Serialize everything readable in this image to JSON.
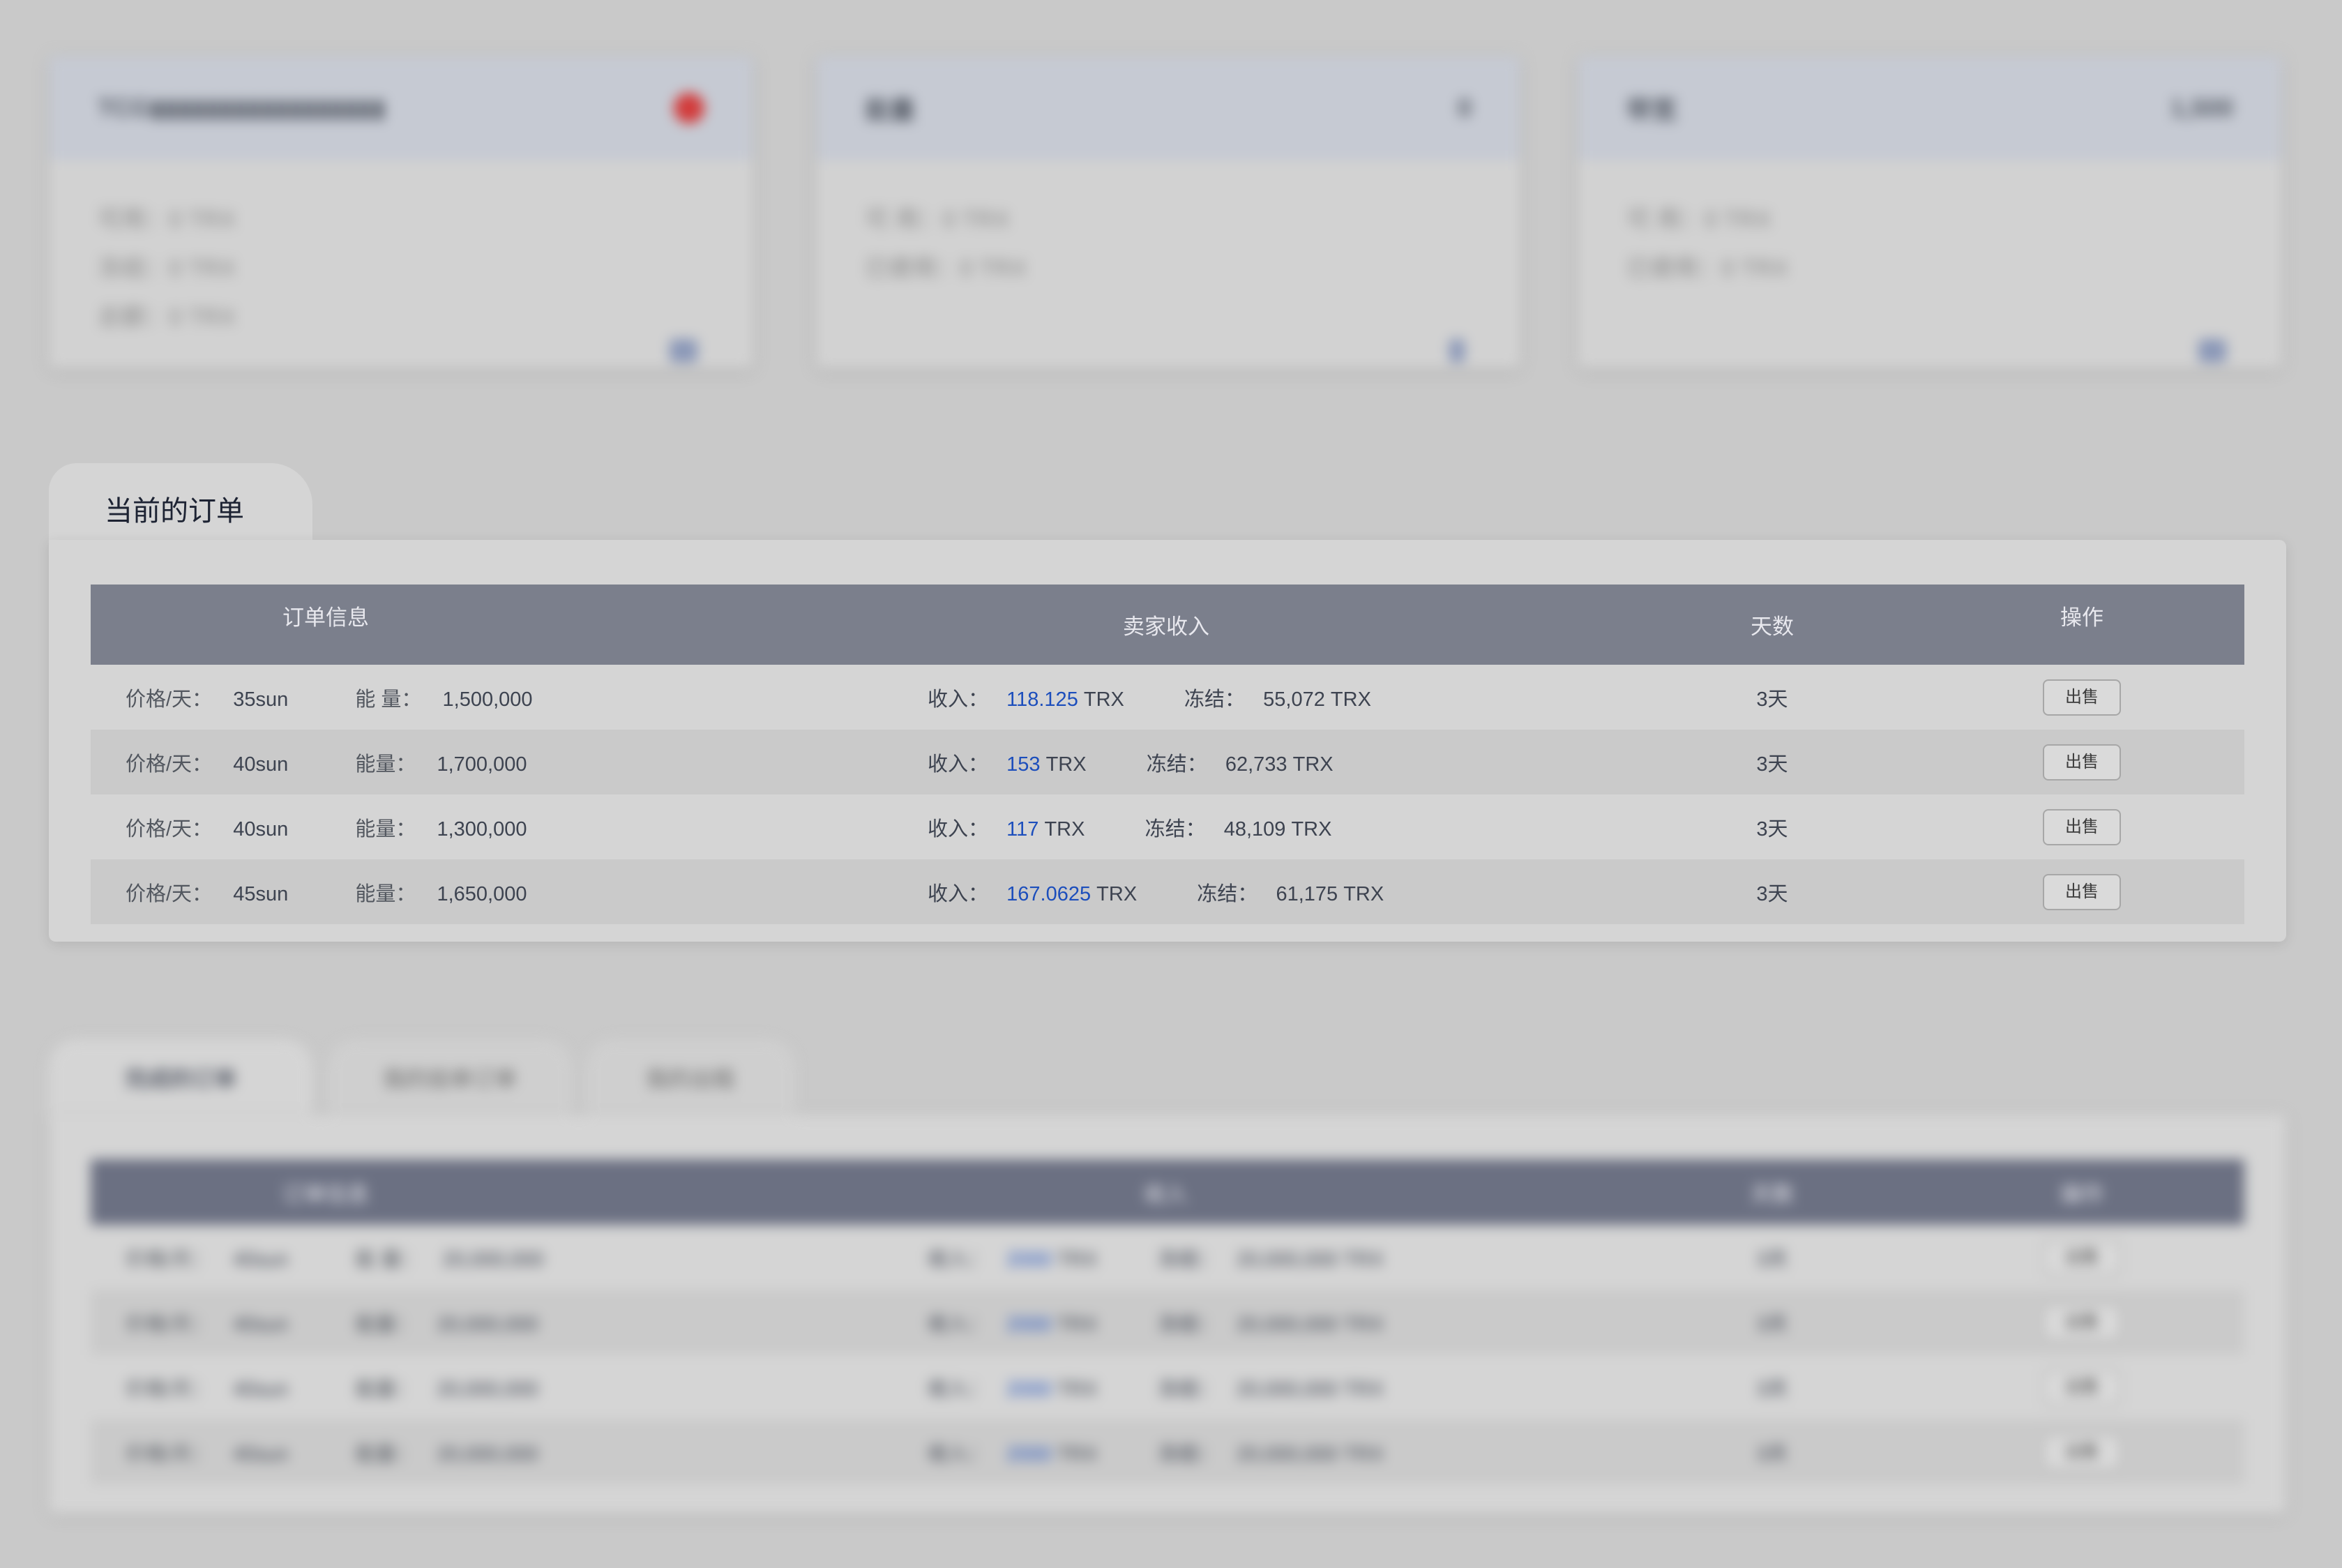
{
  "cards": [
    {
      "title": "TCG▮▮▮▮▮▮▮▮▮▮▮▮▮▮▮▮▮",
      "rows": [
        "可用：0 TRX",
        "冻结：0 TRX",
        "总额：0 TRX"
      ],
      "icon": "status-dot"
    },
    {
      "title": "能量",
      "badge": "0",
      "rows": [
        "可 用：0 TRX",
        "已使用：0 TRX"
      ],
      "icon": "bolt-icon"
    },
    {
      "title": "带宽",
      "badge": "1,500",
      "rows": [
        "可 用：0 TRX",
        "已使用：0 TRX"
      ],
      "icon": "bandwidth-icon"
    }
  ],
  "current_orders": {
    "tab_title": "当前的订单",
    "columns": [
      "订单信息",
      "卖家收入",
      "天数",
      "操作"
    ],
    "rows": [
      {
        "price_label": "价格/天：",
        "price": "35sun",
        "energy_label": "能 量：",
        "energy": "1,500,000",
        "income_label": "收入：",
        "income": "118.125",
        "income_unit": "TRX",
        "frozen_label": "冻结：",
        "frozen": "55,072 TRX",
        "days": "3天",
        "action": "出售"
      },
      {
        "price_label": "价格/天：",
        "price": "40sun",
        "energy_label": "能量：",
        "energy": "1,700,000",
        "income_label": "收入：",
        "income": "153",
        "income_unit": "TRX",
        "frozen_label": "冻结：",
        "frozen": "62,733 TRX",
        "days": "3天",
        "action": "出售"
      },
      {
        "price_label": "价格/天：",
        "price": "40sun",
        "energy_label": "能量：",
        "energy": "1,300,000",
        "income_label": "收入：",
        "income": "117",
        "income_unit": "TRX",
        "frozen_label": "冻结：",
        "frozen": "48,109 TRX",
        "days": "3天",
        "action": "出售"
      },
      {
        "price_label": "价格/天：",
        "price": "45sun",
        "energy_label": "能量：",
        "energy": "1,650,000",
        "income_label": "收入：",
        "income": "167.0625",
        "income_unit": "TRX",
        "frozen_label": "冻结：",
        "frozen": "61,175 TRX",
        "days": "3天",
        "action": "出售"
      }
    ]
  },
  "lower": {
    "tabs": [
      "完成的订单",
      "我的挂单订单",
      "我的出租"
    ],
    "columns": [
      "订单信息",
      "收入",
      "天数",
      "操作"
    ],
    "rows": [
      {
        "price_label": "价格/天：",
        "price": "40sun",
        "energy_label": "能 量：",
        "energy": "20,000,000",
        "income_label": "收入：",
        "income": "2000",
        "income_unit": "TRX",
        "frozen_label": "冻结：",
        "frozen": "20,000,000 TRX",
        "days": "3天",
        "action": "出售"
      },
      {
        "price_label": "价格/天：",
        "price": "40sun",
        "energy_label": "能量：",
        "energy": "20,000,000",
        "income_label": "收入：",
        "income": "2000",
        "income_unit": "TRX",
        "frozen_label": "冻结：",
        "frozen": "20,000,000 TRX",
        "days": "3天",
        "action": "出售"
      },
      {
        "price_label": "价格/天：",
        "price": "40sun",
        "energy_label": "能量：",
        "energy": "20,000,000",
        "income_label": "收入：",
        "income": "2000",
        "income_unit": "TRX",
        "frozen_label": "冻结：",
        "frozen": "20,000,000 TRX",
        "days": "3天",
        "action": "出售"
      },
      {
        "price_label": "价格/天：",
        "price": "40sun",
        "energy_label": "能量：",
        "energy": "20,000,000",
        "income_label": "收入：",
        "income": "2000",
        "income_unit": "TRX",
        "frozen_label": "冻结：",
        "frozen": "20,000,000 TRX",
        "days": "3天",
        "action": "出售"
      }
    ]
  }
}
